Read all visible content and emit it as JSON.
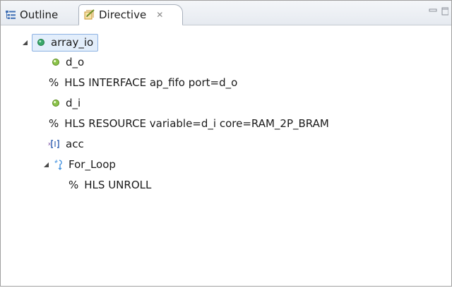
{
  "tabs": {
    "outline_label": "Outline",
    "directive_label": "Directive",
    "close_glyph": "✕"
  },
  "tree": {
    "root": "array_io",
    "d_o": "d_o",
    "pct": "%",
    "d_o_directive": "HLS INTERFACE ap_fifo port=d_o",
    "d_i": "d_i",
    "d_i_directive": "HLS RESOURCE variable=d_i core=RAM_2P_BRAM",
    "acc": "acc",
    "loop": "For_Loop",
    "loop_directive": "HLS UNROLL"
  },
  "colors": {
    "selection_bg": "#e3eefb",
    "selection_border": "#8db2e3",
    "function_icon": "#3aa86b",
    "port_icon": "#8bc34a",
    "loop_icon": "#3a8dde"
  },
  "icons": {
    "outline_tab": "outline-icon",
    "directive_tab": "directive-icon",
    "function": "function-icon",
    "port": "port-icon",
    "array": "array-variable-icon",
    "loop": "loop-icon"
  }
}
